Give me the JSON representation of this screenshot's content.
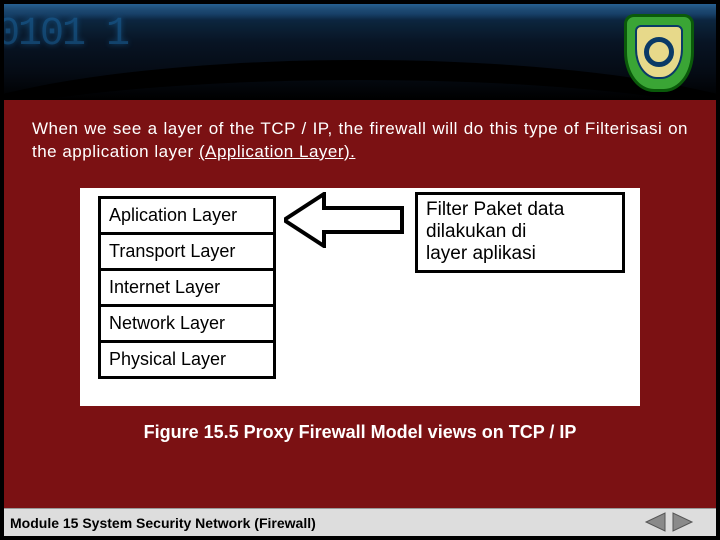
{
  "header": {
    "decor_digits": "0101  1",
    "logo_name": "shield-logo"
  },
  "body": {
    "intro_prefix": "When we see a layer of the TCP / IP, the firewall will do this type of Filterisasi on the application layer ",
    "intro_underlined": "(Application Layer).",
    "caption": "Figure 15.5 Proxy Firewall Model views on TCP / IP"
  },
  "diagram": {
    "layers": [
      "Aplication Layer",
      "Transport Layer",
      "Internet  Layer",
      "Network  Layer",
      "Physical Layer"
    ],
    "filter_lines": [
      "Filter Paket data",
      "dilakukan di",
      "layer aplikasi"
    ]
  },
  "footer": {
    "module": "Module 15 System Security Network (Firewall)"
  },
  "nav": {
    "prev": "previous-slide",
    "next": "next-slide"
  },
  "colors": {
    "slide_bg": "#7b1113",
    "footer_bg": "#dddddd"
  }
}
